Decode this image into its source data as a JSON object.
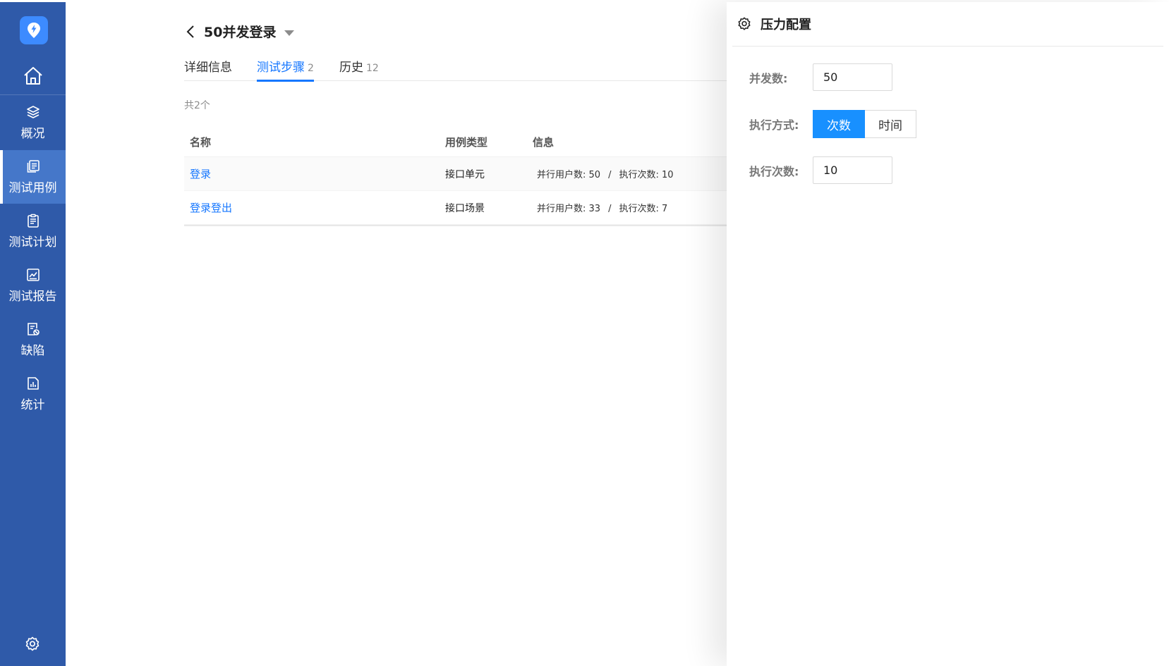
{
  "sidebar": {
    "items": [
      {
        "label": "概况",
        "icon": "layers-icon"
      },
      {
        "label": "测试用例",
        "icon": "test-case-icon",
        "active": true
      },
      {
        "label": "测试计划",
        "icon": "clipboard-icon"
      },
      {
        "label": "测试报告",
        "icon": "report-chart-icon"
      },
      {
        "label": "缺陷",
        "icon": "defect-icon"
      },
      {
        "label": "统计",
        "icon": "statistics-icon"
      }
    ]
  },
  "header": {
    "title": "50并发登录"
  },
  "tabs": [
    {
      "label": "详细信息",
      "count": ""
    },
    {
      "label": "测试步骤",
      "count": "2"
    },
    {
      "label": "历史",
      "count": "12"
    }
  ],
  "total_text": "共2个",
  "table": {
    "columns": [
      "名称",
      "用例类型",
      "信息"
    ],
    "rows": [
      {
        "name": "登录",
        "type": "接口单元",
        "users": "并行用户数: 50",
        "sep": "/",
        "runs": "执行次数: 10"
      },
      {
        "name": "登录登出",
        "type": "接口场景",
        "users": "并行用户数: 33",
        "sep": "/",
        "runs": "执行次数: 7"
      }
    ]
  },
  "drawer": {
    "title": "压力配置",
    "concurrency_label": "并发数:",
    "concurrency_value": "50",
    "mode_label": "执行方式:",
    "mode_options": [
      "次数",
      "时间"
    ],
    "mode_selected": "次数",
    "runs_label": "执行次数:",
    "runs_value": "10"
  },
  "colors": {
    "sidebar": "#2f5aa9",
    "sidebar_active": "#4577c9",
    "accent": "#1677ff",
    "segment_selected": "#1890ff"
  }
}
